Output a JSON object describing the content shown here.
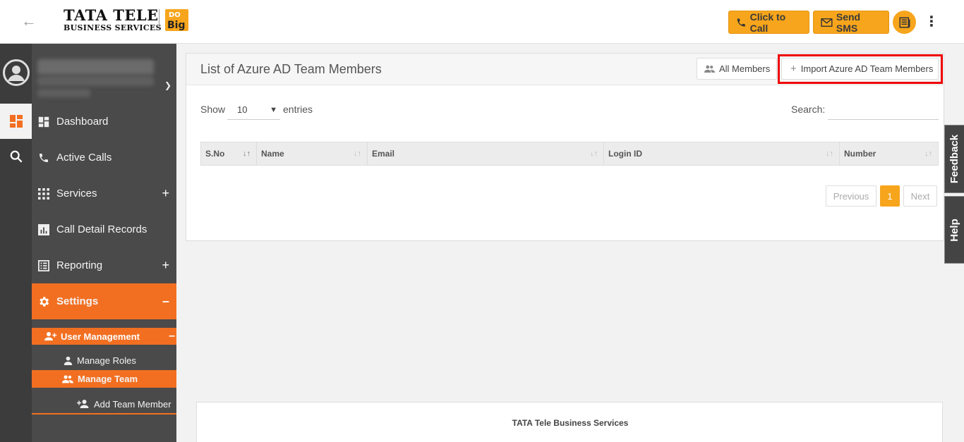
{
  "header": {
    "logo_line1": "TATA TELE",
    "logo_line2": "BUSINESS SERVICES",
    "logo_badge_top": "DO",
    "logo_badge_bottom": "Big",
    "click_to_call": "Click to Call",
    "send_sms": "Send SMS",
    "accent": "#f7a51c"
  },
  "sidebar": {
    "items": [
      {
        "label": "Dashboard",
        "icon": "dashboard-icon"
      },
      {
        "label": "Active Calls",
        "icon": "phone-icon"
      },
      {
        "label": "Services",
        "icon": "grid-icon",
        "expand": "+"
      },
      {
        "label": "Call Detail Records",
        "icon": "chart-icon"
      },
      {
        "label": "Reporting",
        "icon": "list-icon",
        "expand": "+"
      },
      {
        "label": "Settings",
        "icon": "gear-icon",
        "expand": "–"
      }
    ],
    "sub_header": {
      "label": "User Management",
      "expand": "–"
    },
    "sub_items": [
      {
        "label": "Manage Roles"
      },
      {
        "label": "Manage Team"
      },
      {
        "label": "Add Team Member"
      }
    ],
    "active_color": "#f26f21"
  },
  "main": {
    "title": "List of Azure AD Team Members",
    "all_members": "All Members",
    "import_button": "Import Azure AD Team Members",
    "show_label": "Show",
    "show_value": "10",
    "entries_label": "entries",
    "search_label": "Search:",
    "columns": [
      "S.No",
      "Name",
      "Email",
      "Login ID",
      "Number"
    ],
    "pagination": {
      "previous": "Previous",
      "current": "1",
      "next": "Next"
    }
  },
  "side_tabs": {
    "feedback": "Feedback",
    "help": "Help"
  },
  "footer": {
    "text": "TATA Tele Business Services"
  }
}
